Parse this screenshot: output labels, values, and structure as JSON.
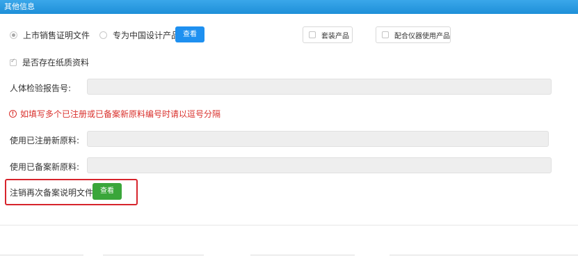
{
  "header": {
    "title": "其他信息"
  },
  "radios": [
    {
      "label": "上市销售证明文件",
      "checked": true
    },
    {
      "label": "专为中国设计产品",
      "checked": false
    }
  ],
  "view_button_label": "查看",
  "checkbox_buttons": [
    {
      "label": "套装产品",
      "checked": false
    },
    {
      "label": "配合仪器使用产品",
      "checked": false
    }
  ],
  "paper_checkbox": {
    "label": "是否存在纸质资料",
    "checked": true
  },
  "fields": {
    "human_test_report": {
      "label": "人体检验报告号:",
      "value": ""
    },
    "registered_raw": {
      "label": "使用已注册新原料:",
      "value": ""
    },
    "filed_raw": {
      "label": "使用已备案新原料:",
      "value": ""
    }
  },
  "warning": {
    "text": "如填写多个已注册或已备案新原料编号时请以逗号分隔"
  },
  "cancel_refile": {
    "label": "注销再次备案说明文件:",
    "button_label": "查看"
  },
  "colors": {
    "accent_blue": "#1e90f0",
    "accent_green": "#3aa63a",
    "warning_red": "#d9302c",
    "highlight_red": "#d7242c"
  }
}
